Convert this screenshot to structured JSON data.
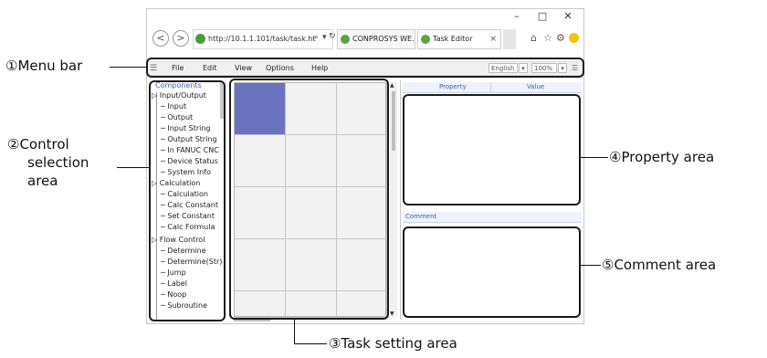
{
  "browser": {
    "address": "http://10.1.1.101/task/task.ht",
    "address_controls": [
      "⌕",
      "▾",
      "↻"
    ],
    "tabs": [
      {
        "label": "CONPROSYS WE...",
        "active": false
      },
      {
        "label": "Task Editor",
        "active": true
      }
    ],
    "tab_close": "×",
    "window_controls": [
      "–",
      "□",
      "✕"
    ]
  },
  "menubar": {
    "items": [
      "File",
      "Edit",
      "View",
      "Options",
      "Help"
    ],
    "language": "English",
    "zoom": "100%"
  },
  "control_tree": {
    "root": "Components",
    "groups": [
      {
        "label": "Input/Output",
        "items": [
          "Input",
          "Output",
          "Input String",
          "Output String",
          "In FANUC CNC",
          "Device Status",
          "System Info"
        ]
      },
      {
        "label": "Calculation",
        "items": [
          "Calculation",
          "Calc Constant",
          "Set Constant",
          "Calc Formula"
        ]
      },
      {
        "label": "Flow Control",
        "items": [
          "Determine",
          "Determine(Str)",
          "Jump",
          "Label",
          "Noop",
          "Subroutine"
        ]
      }
    ]
  },
  "property_area": {
    "headers": [
      "Property",
      "Value"
    ]
  },
  "comment_area": {
    "header": "Comment"
  },
  "callouts": {
    "menu_bar": "①Menu bar",
    "control_selection": [
      "②Control",
      "selection",
      "area"
    ],
    "task_setting": "③Task setting area",
    "property": "④Property area",
    "comment": "⑤Comment area"
  },
  "colors": {
    "selected_cell": "#6b72bd",
    "header_text": "#3a5fa8"
  }
}
